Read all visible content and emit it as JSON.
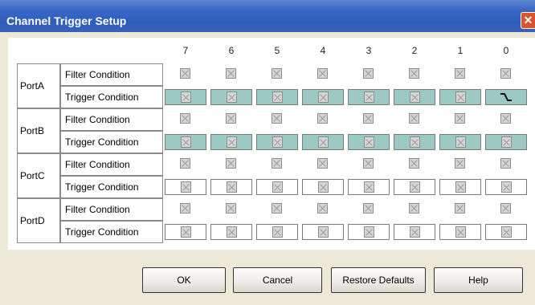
{
  "window": {
    "title": "Channel Trigger Setup",
    "close_glyph": "✕"
  },
  "columns": [
    "7",
    "6",
    "5",
    "4",
    "3",
    "2",
    "1",
    "0"
  ],
  "ports": [
    {
      "name": "PortA",
      "filter_label": "Filter Condition",
      "trigger_label": "Trigger Condition",
      "trigger_style": "teal",
      "trigger_values": [
        "none",
        "none",
        "none",
        "none",
        "none",
        "none",
        "none",
        "falling-edge"
      ]
    },
    {
      "name": "PortB",
      "filter_label": "Filter Condition",
      "trigger_label": "Trigger Condition",
      "trigger_style": "teal",
      "trigger_values": [
        "none",
        "none",
        "none",
        "none",
        "none",
        "none",
        "none",
        "none"
      ]
    },
    {
      "name": "PortC",
      "filter_label": "Filter Condition",
      "trigger_label": "Trigger Condition",
      "trigger_style": "white",
      "trigger_values": [
        "none",
        "none",
        "none",
        "none",
        "none",
        "none",
        "none",
        "none"
      ]
    },
    {
      "name": "PortD",
      "filter_label": "Filter Condition",
      "trigger_label": "Trigger Condition",
      "trigger_style": "white",
      "trigger_values": [
        "none",
        "none",
        "none",
        "none",
        "none",
        "none",
        "none",
        "none"
      ]
    }
  ],
  "buttons": {
    "ok": "OK",
    "cancel": "Cancel",
    "restore": "Restore Defaults",
    "help": "Help"
  },
  "colors": {
    "title_bar": "#3b68c5",
    "trigger_teal": "#9cc9c3",
    "close": "#d9542b",
    "dialog_bg": "#ece9d8"
  }
}
